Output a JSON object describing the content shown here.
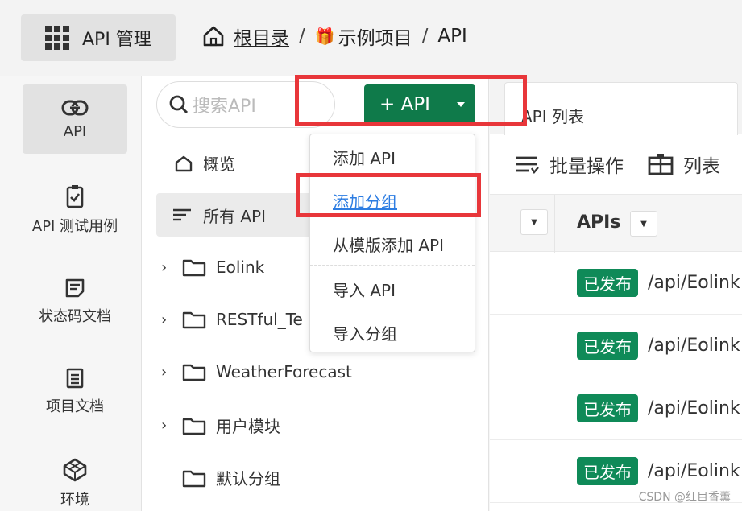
{
  "header": {
    "app_title": "API 管理",
    "breadcrumb": {
      "root": "根目录",
      "sep1": "/",
      "project": "示例项目",
      "sep2": "/",
      "current": "API"
    }
  },
  "leftnav": [
    {
      "label": "API",
      "icon": "link-icon"
    },
    {
      "label": "API 测试用例",
      "icon": "clipboard-check-icon"
    },
    {
      "label": "状态码文档",
      "icon": "note-icon"
    },
    {
      "label": "项目文档",
      "icon": "document-icon"
    },
    {
      "label": "环境",
      "icon": "cube-icon"
    }
  ],
  "tree": {
    "search_placeholder": "搜索API",
    "add_button_label": "+ API",
    "overview_label": "概览",
    "all_api_label": "所有 API",
    "groups": [
      "Eolink",
      "RESTful_Te",
      "WeatherForecast",
      "用户模块",
      "默认分组"
    ]
  },
  "dropdown": {
    "items": [
      "添加 API",
      "添加分组",
      "从模版添加 API",
      "导入 API",
      "导入分组"
    ]
  },
  "content": {
    "tab_label": "API 列表",
    "toolbar": {
      "batch_label": "批量操作",
      "list_label": "列表"
    },
    "table_header": {
      "apis_label": "APIs"
    },
    "rows": [
      {
        "status": "已发布",
        "path": "/api/Eolink"
      },
      {
        "status": "已发布",
        "path": "/api/Eolink"
      },
      {
        "status": "已发布",
        "path": "/api/Eolink"
      },
      {
        "status": "已发布",
        "path": "/api/Eolink"
      }
    ]
  },
  "watermark": "CSDN @红目香薰",
  "colors": {
    "accent": "#0f7a4a",
    "badge": "#0f8a58",
    "highlight": "#e8363a",
    "link": "#2d7de2"
  }
}
